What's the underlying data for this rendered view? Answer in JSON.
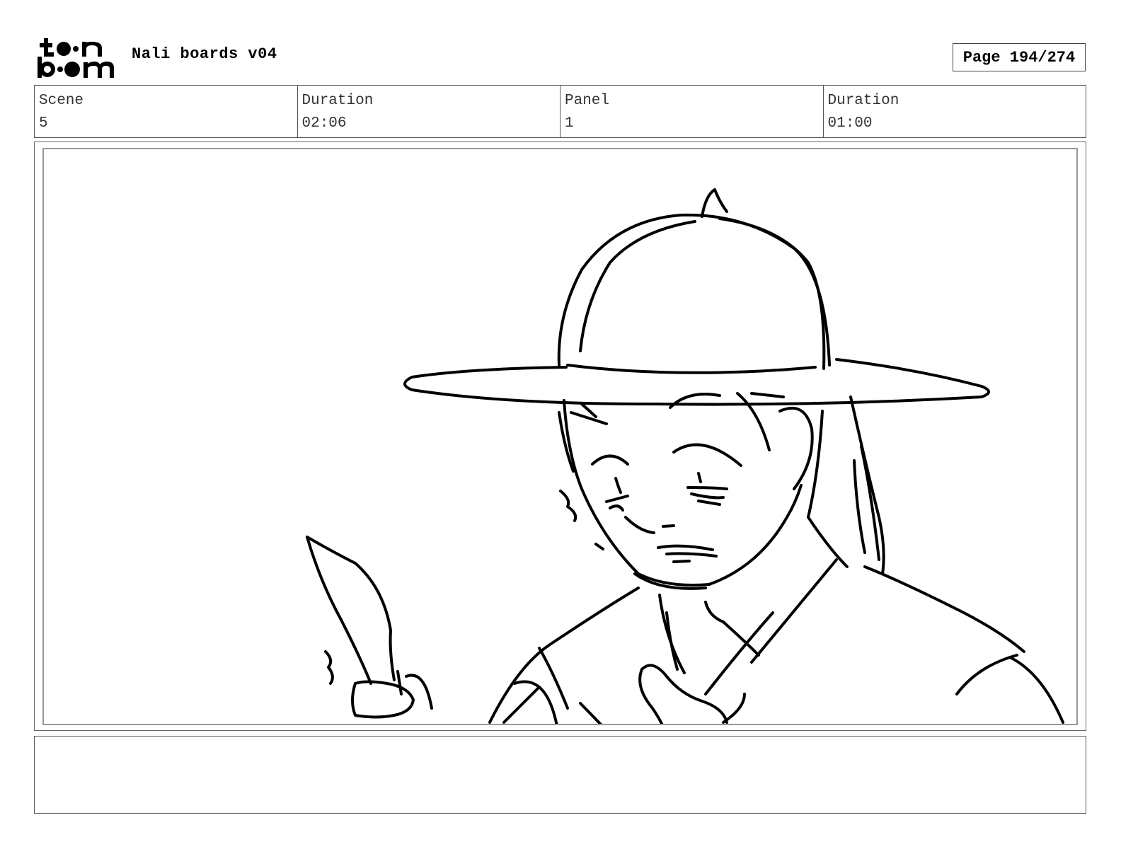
{
  "header": {
    "logo_icon": "toon-boom-logo",
    "title": "Nali boards v04",
    "page": "Page 194/274"
  },
  "info": [
    {
      "label": "Scene",
      "value": "5"
    },
    {
      "label": "Duration",
      "value": "02:06"
    },
    {
      "label": "Panel",
      "value": "1"
    },
    {
      "label": "Duration",
      "value": "01:00"
    }
  ],
  "panel": {
    "sketch_icon": "character-with-hat-and-knife-sketch"
  },
  "notes": {
    "text": ""
  }
}
